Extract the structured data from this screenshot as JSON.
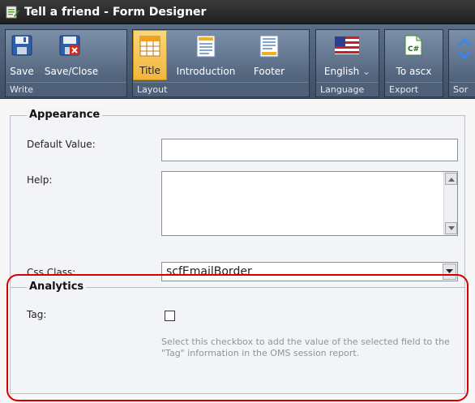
{
  "window": {
    "title": "Tell a friend - Form Designer",
    "icon": "form-designer-icon"
  },
  "ribbon": {
    "groups": [
      {
        "caption": "Write",
        "buttons": [
          {
            "label": "Save",
            "icon": "floppy-disk-icon"
          },
          {
            "label": "Save/Close",
            "icon": "save-close-icon"
          }
        ]
      },
      {
        "caption": "Layout",
        "buttons": [
          {
            "label": "Title",
            "icon": "grid-icon",
            "active": true
          },
          {
            "label": "Introduction",
            "icon": "introduction-icon"
          },
          {
            "label": "Footer",
            "icon": "footer-icon"
          }
        ]
      },
      {
        "caption": "Language",
        "buttons": [
          {
            "label": "English",
            "icon": "us-flag-icon",
            "dropdown": "⌄"
          }
        ]
      },
      {
        "caption": "Export",
        "buttons": [
          {
            "label": "To ascx",
            "icon": "csharp-file-icon"
          }
        ]
      },
      {
        "caption": "Sor",
        "buttons": [
          {
            "label": "",
            "icon": "sort-arrows-icon"
          }
        ]
      }
    ]
  },
  "appearance": {
    "legend": "Appearance",
    "default_value_label": "Default Value:",
    "default_value": "",
    "help_label": "Help:",
    "help_value": "",
    "css_class_label": "Css Class:",
    "css_class_value": "scfEmailBorder"
  },
  "analytics": {
    "legend": "Analytics",
    "tag_label": "Tag:",
    "tag_checked": false,
    "hint": "Select this checkbox to add the value of the selected field to the \"Tag\" information in the OMS session report."
  },
  "colors": {
    "highlight": "#d40000",
    "active_button": "#f3b53c"
  }
}
